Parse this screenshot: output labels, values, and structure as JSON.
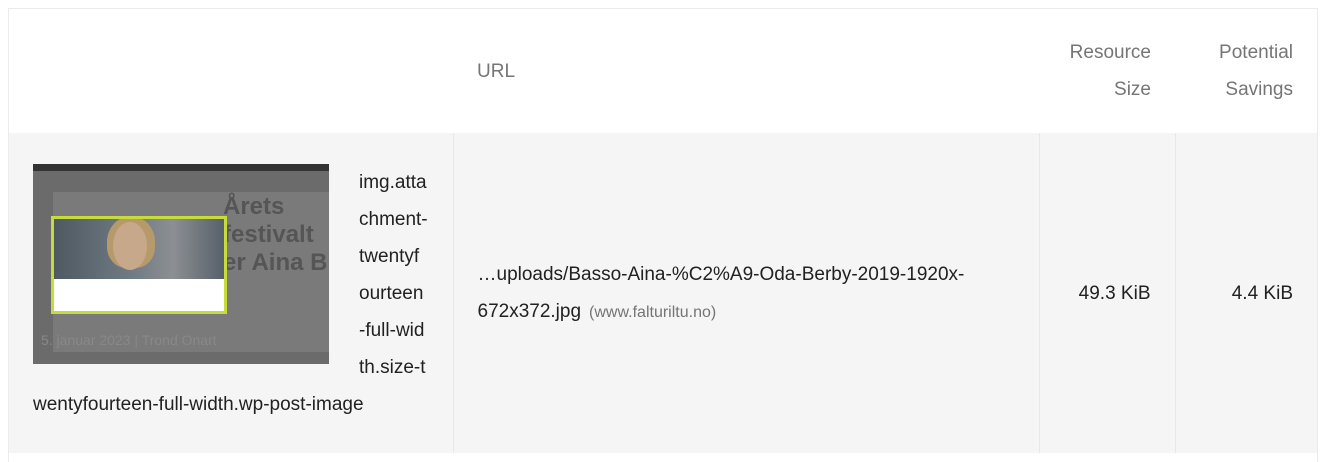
{
  "table": {
    "headers": {
      "element": "",
      "url": "URL",
      "resource_size": "Resource Size",
      "potential_savings": "Potential Savings"
    },
    "rows": [
      {
        "selector": "img.attachment-twentyfourteen-full-width.size-twentyfourteen-full-width.wp-post-image",
        "url_path": "…uploads/Basso-Aina-%C2%A9-Oda-Berby-2019-1920x-672x372.jpg",
        "url_host": "(www.falturiltu.no)",
        "resource_size": "49.3 KiB",
        "potential_savings": "4.4 KiB",
        "thumbnail": {
          "title_lines": [
            "Årets",
            "festivalt",
            "er Aina B"
          ],
          "meta": "5. januar 2023 | Trond Onart"
        }
      }
    ]
  },
  "colors": {
    "highlight": "#c5dc3c",
    "row_background": "#f5f5f5",
    "header_text": "#757575"
  }
}
